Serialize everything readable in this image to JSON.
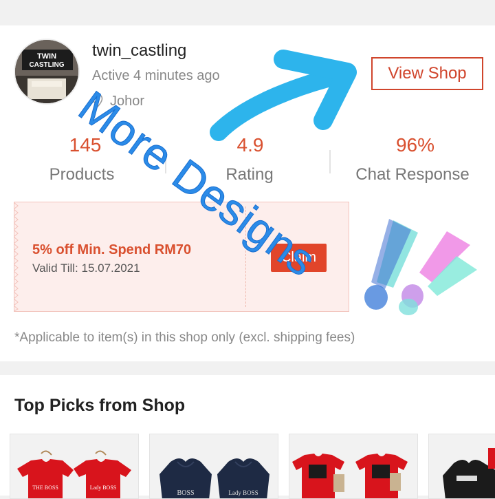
{
  "shop": {
    "name": "twin_castling",
    "active": "Active 4 minutes ago",
    "location": "Johor",
    "view_shop_label": "View Shop",
    "logo_text_1": "TWIN",
    "logo_text_2": "CASTLING"
  },
  "stats": [
    {
      "value": "145",
      "label": "Products"
    },
    {
      "value": "4.9",
      "label": "Rating"
    },
    {
      "value": "96%",
      "label": "Chat Response"
    }
  ],
  "voucher": {
    "title": "5% off Min. Spend RM70",
    "valid": "Valid Till: 15.07.2021",
    "claim_label": "Claim"
  },
  "note": "*Applicable to item(s) in this shop only (excl. shipping fees)",
  "top_picks": {
    "title": "Top Picks from Shop",
    "products": [
      {
        "color": "#d8141c",
        "print_1": "THE BOSS",
        "print_2": "Lady BOSS"
      },
      {
        "color": "#1e2a44",
        "print_1": "BOSS",
        "print_2": "Lady BOSS"
      },
      {
        "color": "#d8141c",
        "print_1": "",
        "print_2": ""
      },
      {
        "color": "#1b1b1b",
        "print_1": "",
        "print_2": ""
      }
    ]
  },
  "overlay": {
    "text": "More Designs",
    "text_color": "#2b8be8",
    "arrow_color": "#2db4ec"
  },
  "colors": {
    "accent": "#d9502f",
    "claim": "#e1452a"
  }
}
